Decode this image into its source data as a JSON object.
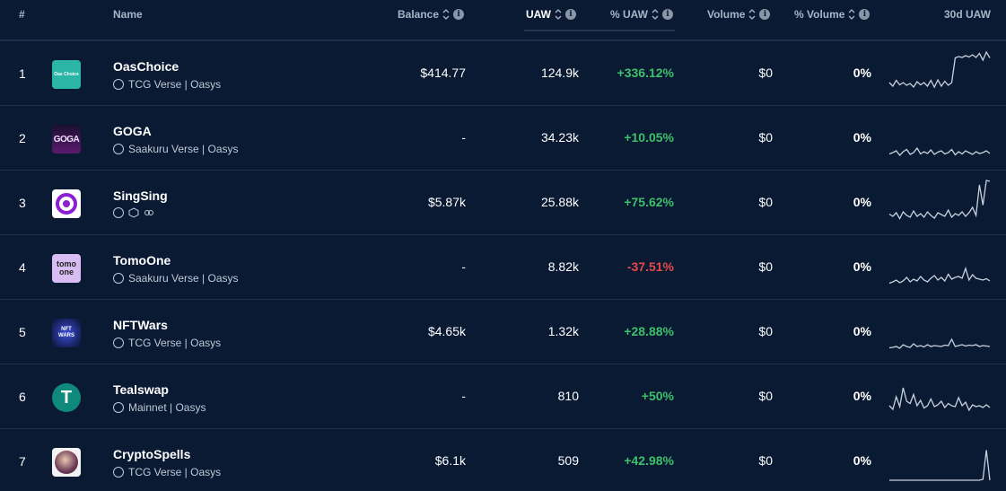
{
  "header": {
    "rank": "#",
    "name": "Name",
    "balance": "Balance",
    "uaw": "UAW",
    "pct_uaw": "% UAW",
    "volume": "Volume",
    "pct_volume": "% Volume",
    "uaw_30d": "30d UAW"
  },
  "colors": {
    "background": "#0a1a33",
    "positive": "#3fbf6a",
    "negative": "#e5484d",
    "muted": "#c0c8d6"
  },
  "rows": [
    {
      "rank": "1",
      "name": "OasChoice",
      "chain": "TCG Verse | Oasys",
      "balance": "$414.77",
      "uaw": "124.9k",
      "pct_uaw": "+336.12%",
      "trend": "positive",
      "volume": "$0",
      "pct_volume": "0%",
      "logo_text": "Oas Choice",
      "spark": [
        0.3,
        0.22,
        0.35,
        0.25,
        0.3,
        0.24,
        0.28,
        0.2,
        0.32,
        0.25,
        0.3,
        0.22,
        0.35,
        0.2,
        0.36,
        0.22,
        0.33,
        0.24,
        0.3,
        0.85,
        0.88,
        0.86,
        0.9,
        0.87,
        0.92,
        0.86,
        0.95,
        0.8,
        0.98,
        0.85
      ]
    },
    {
      "rank": "2",
      "name": "GOGA",
      "chain": "Saakuru Verse | Oasys",
      "balance": "-",
      "uaw": "34.23k",
      "pct_uaw": "+10.05%",
      "trend": "positive",
      "volume": "$0",
      "pct_volume": "0%",
      "logo_text": "GOGA",
      "spark": [
        0.15,
        0.18,
        0.22,
        0.12,
        0.2,
        0.25,
        0.14,
        0.18,
        0.28,
        0.15,
        0.2,
        0.16,
        0.24,
        0.14,
        0.19,
        0.22,
        0.15,
        0.18,
        0.25,
        0.13,
        0.2,
        0.15,
        0.22,
        0.18,
        0.14,
        0.2,
        0.16,
        0.18,
        0.22,
        0.16
      ]
    },
    {
      "rank": "3",
      "name": "SingSing",
      "chain": "",
      "balance": "$5.87k",
      "uaw": "25.88k",
      "pct_uaw": "+75.62%",
      "trend": "positive",
      "volume": "$0",
      "pct_volume": "0%",
      "logo_text": "",
      "spark": [
        0.25,
        0.2,
        0.28,
        0.15,
        0.3,
        0.22,
        0.18,
        0.32,
        0.2,
        0.26,
        0.18,
        0.3,
        0.22,
        0.16,
        0.28,
        0.24,
        0.2,
        0.34,
        0.18,
        0.26,
        0.22,
        0.3,
        0.2,
        0.28,
        0.4,
        0.22,
        0.9,
        0.45,
        1.0,
        0.98
      ]
    },
    {
      "rank": "4",
      "name": "TomoOne",
      "chain": "Saakuru Verse | Oasys",
      "balance": "-",
      "uaw": "8.82k",
      "pct_uaw": "-37.51%",
      "trend": "negative",
      "volume": "$0",
      "pct_volume": "0%",
      "logo_text": "tomo one",
      "spark": [
        0.15,
        0.18,
        0.22,
        0.16,
        0.2,
        0.28,
        0.18,
        0.24,
        0.2,
        0.3,
        0.22,
        0.18,
        0.26,
        0.32,
        0.22,
        0.28,
        0.2,
        0.35,
        0.24,
        0.28,
        0.3,
        0.26,
        0.48,
        0.22,
        0.34,
        0.26,
        0.24,
        0.22,
        0.25,
        0.2
      ]
    },
    {
      "rank": "5",
      "name": "NFTWars",
      "chain": "TCG Verse | Oasys",
      "balance": "$4.65k",
      "uaw": "1.32k",
      "pct_uaw": "+28.88%",
      "trend": "positive",
      "volume": "$0",
      "pct_volume": "0%",
      "logo_text": "NFT WARS",
      "spark": [
        0.15,
        0.16,
        0.18,
        0.14,
        0.22,
        0.18,
        0.16,
        0.24,
        0.18,
        0.2,
        0.17,
        0.22,
        0.18,
        0.2,
        0.19,
        0.18,
        0.21,
        0.2,
        0.34,
        0.18,
        0.2,
        0.22,
        0.19,
        0.21,
        0.2,
        0.22,
        0.18,
        0.2,
        0.19,
        0.18
      ]
    },
    {
      "rank": "6",
      "name": "Tealswap",
      "chain": "Mainnet | Oasys",
      "balance": "-",
      "uaw": "810",
      "pct_uaw": "+50%",
      "trend": "positive",
      "volume": "$0",
      "pct_volume": "0%",
      "logo_text": "T",
      "spark": [
        0.3,
        0.22,
        0.5,
        0.28,
        0.7,
        0.4,
        0.35,
        0.55,
        0.3,
        0.42,
        0.25,
        0.3,
        0.45,
        0.28,
        0.32,
        0.4,
        0.26,
        0.35,
        0.3,
        0.28,
        0.48,
        0.3,
        0.38,
        0.2,
        0.32,
        0.28,
        0.3,
        0.26,
        0.32,
        0.26
      ]
    },
    {
      "rank": "7",
      "name": "CryptoSpells",
      "chain": "TCG Verse | Oasys",
      "balance": "$6.1k",
      "uaw": "509",
      "pct_uaw": "+42.98%",
      "trend": "positive",
      "volume": "$0",
      "pct_volume": "0%",
      "logo_text": "",
      "spark": [
        0.08,
        0.08,
        0.08,
        0.08,
        0.08,
        0.08,
        0.08,
        0.08,
        0.08,
        0.08,
        0.08,
        0.08,
        0.08,
        0.08,
        0.08,
        0.08,
        0.08,
        0.08,
        0.08,
        0.08,
        0.08,
        0.08,
        0.08,
        0.08,
        0.08,
        0.08,
        0.08,
        0.1,
        0.75,
        0.08
      ]
    }
  ]
}
